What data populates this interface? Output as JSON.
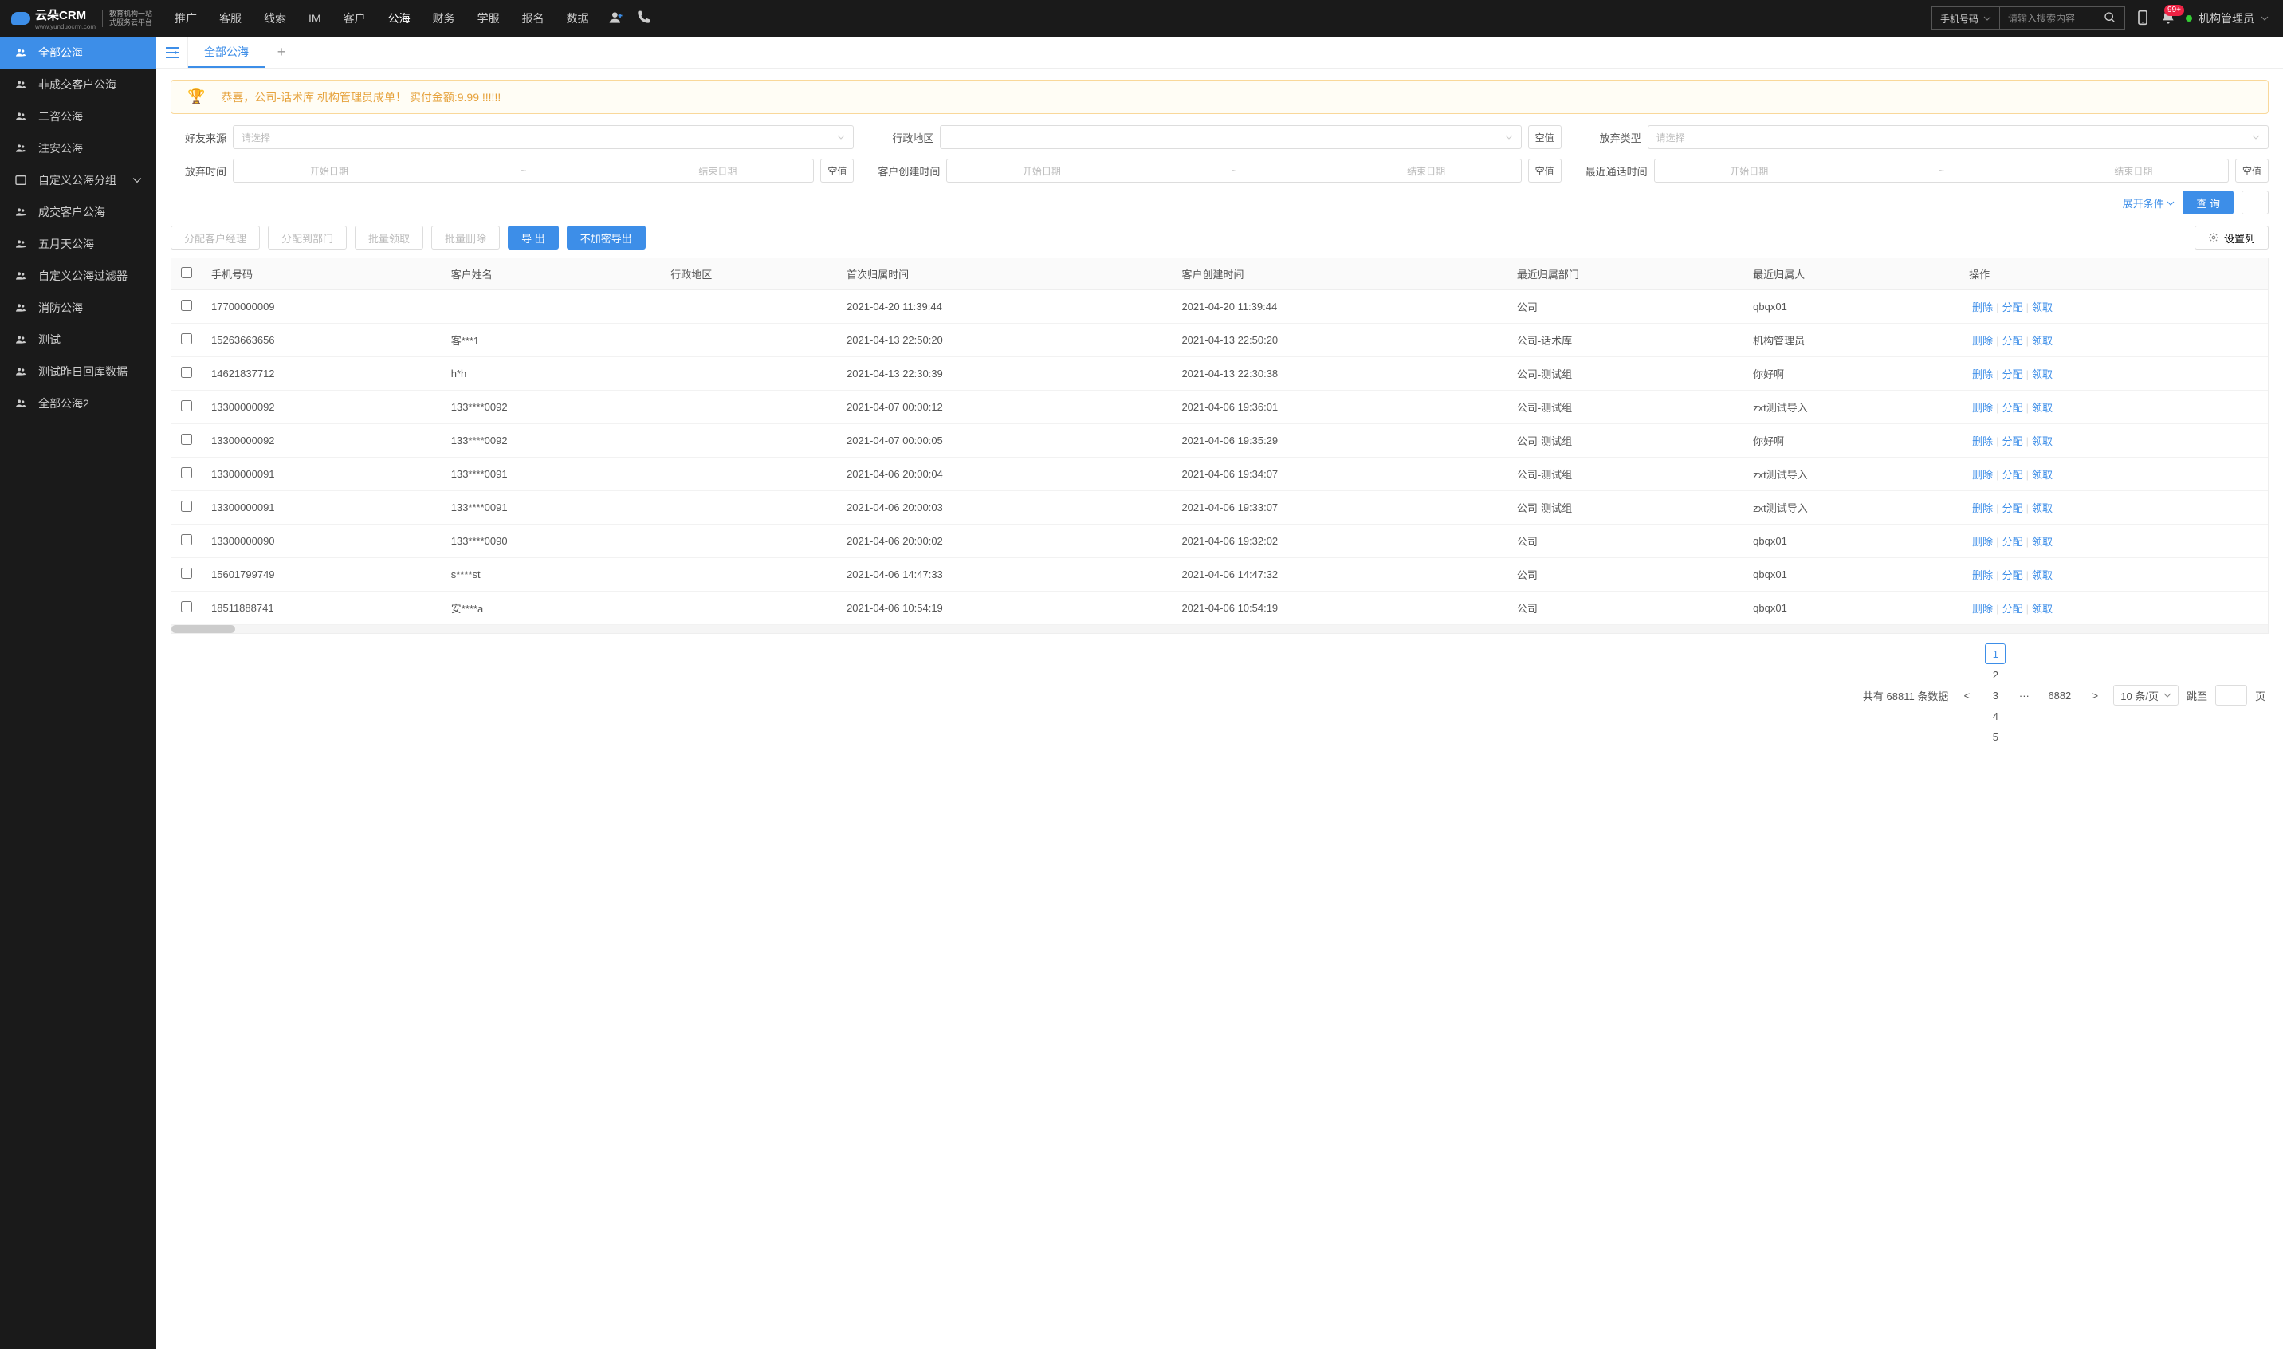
{
  "brand": {
    "name": "云朵CRM",
    "url": "www.yunduocrm.com",
    "sub1": "教育机构一站",
    "sub2": "式服务云平台"
  },
  "topnav": [
    "推广",
    "客服",
    "线索",
    "IM",
    "客户",
    "公海",
    "财务",
    "学服",
    "报名",
    "数据"
  ],
  "topnav_active": 5,
  "search": {
    "type": "手机号码",
    "placeholder": "请输入搜索内容"
  },
  "notif_badge": "99+",
  "user_name": "机构管理员",
  "sidebar": [
    {
      "label": "全部公海",
      "active": true,
      "ico": "users"
    },
    {
      "label": "非成交客户公海",
      "ico": "users"
    },
    {
      "label": "二咨公海",
      "ico": "users"
    },
    {
      "label": "注安公海",
      "ico": "users"
    },
    {
      "label": "自定义公海分组",
      "ico": "folder",
      "arrow": true
    },
    {
      "label": "成交客户公海",
      "ico": "users"
    },
    {
      "label": "五月天公海",
      "ico": "users"
    },
    {
      "label": "自定义公海过滤器",
      "ico": "users"
    },
    {
      "label": "消防公海",
      "ico": "users"
    },
    {
      "label": "测试",
      "ico": "users"
    },
    {
      "label": "测试昨日回库数据",
      "ico": "users"
    },
    {
      "label": "全部公海2",
      "ico": "users"
    }
  ],
  "tab": {
    "label": "全部公海"
  },
  "banner": "恭喜，公司-话术库  机构管理员成单！  实付金额:9.99 !!!!!!",
  "filters": {
    "pick": "请选择",
    "source": "好友来源",
    "region": "行政地区",
    "give_type": "放弃类型",
    "give_time": "放弃时间",
    "create_time": "客户创建时间",
    "call_time": "最近通话时间",
    "start": "开始日期",
    "end": "结束日期",
    "empty": "空值"
  },
  "filter_actions": {
    "expand": "展开条件",
    "query": "查 询"
  },
  "toolbar": {
    "assign_mgr": "分配客户经理",
    "assign_dept": "分配到部门",
    "bulk_take": "批量领取",
    "bulk_del": "批量删除",
    "export": "导 出",
    "export_plain": "不加密导出",
    "cols": "设置列"
  },
  "columns": [
    "手机号码",
    "客户姓名",
    "行政地区",
    "首次归属时间",
    "客户创建时间",
    "最近归属部门",
    "最近归属人",
    "操作"
  ],
  "row_actions": {
    "del": "删除",
    "assign": "分配",
    "take": "领取"
  },
  "rows": [
    {
      "phone": "17700000009",
      "name": "",
      "region": "",
      "first": "2021-04-20 11:39:44",
      "created": "2021-04-20 11:39:44",
      "dept": "公司",
      "owner": "qbqx01"
    },
    {
      "phone": "15263663656",
      "name": "客***1",
      "region": "",
      "first": "2021-04-13 22:50:20",
      "created": "2021-04-13 22:50:20",
      "dept": "公司-话术库",
      "owner": "机构管理员"
    },
    {
      "phone": "14621837712",
      "name": "h*h",
      "region": "",
      "first": "2021-04-13 22:30:39",
      "created": "2021-04-13 22:30:38",
      "dept": "公司-测试组",
      "owner": "你好啊"
    },
    {
      "phone": "13300000092",
      "name": "133****0092",
      "region": "",
      "first": "2021-04-07 00:00:12",
      "created": "2021-04-06 19:36:01",
      "dept": "公司-测试组",
      "owner": "zxt测试导入"
    },
    {
      "phone": "13300000092",
      "name": "133****0092",
      "region": "",
      "first": "2021-04-07 00:00:05",
      "created": "2021-04-06 19:35:29",
      "dept": "公司-测试组",
      "owner": "你好啊"
    },
    {
      "phone": "13300000091",
      "name": "133****0091",
      "region": "",
      "first": "2021-04-06 20:00:04",
      "created": "2021-04-06 19:34:07",
      "dept": "公司-测试组",
      "owner": "zxt测试导入"
    },
    {
      "phone": "13300000091",
      "name": "133****0091",
      "region": "",
      "first": "2021-04-06 20:00:03",
      "created": "2021-04-06 19:33:07",
      "dept": "公司-测试组",
      "owner": "zxt测试导入"
    },
    {
      "phone": "13300000090",
      "name": "133****0090",
      "region": "",
      "first": "2021-04-06 20:00:02",
      "created": "2021-04-06 19:32:02",
      "dept": "公司",
      "owner": "qbqx01"
    },
    {
      "phone": "15601799749",
      "name": "s****st",
      "region": "",
      "first": "2021-04-06 14:47:33",
      "created": "2021-04-06 14:47:32",
      "dept": "公司",
      "owner": "qbqx01"
    },
    {
      "phone": "18511888741",
      "name": "安****a",
      "region": "",
      "first": "2021-04-06 10:54:19",
      "created": "2021-04-06 10:54:19",
      "dept": "公司",
      "owner": "qbqx01"
    }
  ],
  "pager": {
    "total_pre": "共有",
    "total": "68811",
    "total_suf": "条数据",
    "pages": [
      "1",
      "2",
      "3",
      "4",
      "5"
    ],
    "last": "6882",
    "size": "10 条/页",
    "jump": "跳至",
    "jump_suf": "页"
  }
}
